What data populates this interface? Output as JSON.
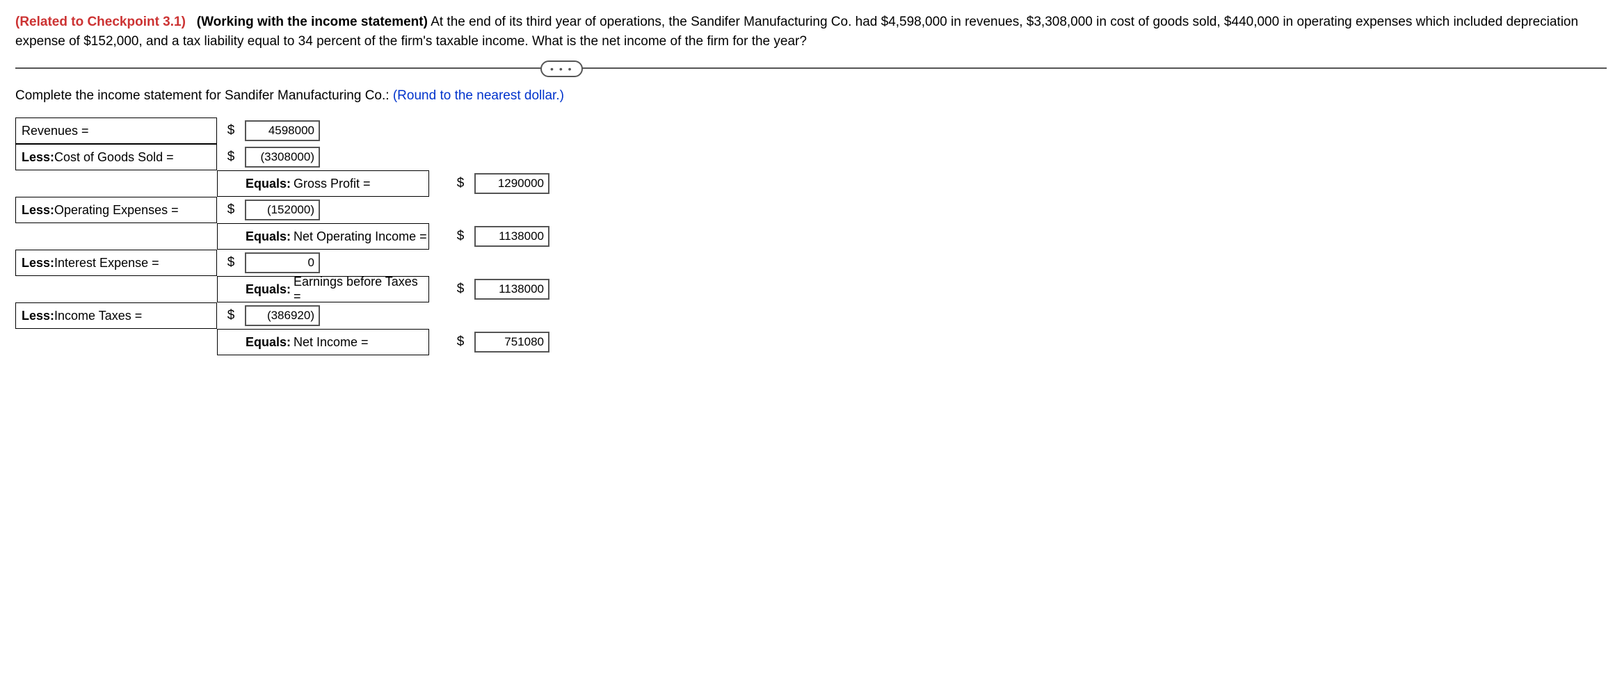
{
  "problem": {
    "checkpoint": "(Related to Checkpoint 3.1)",
    "title": "(Working with the income statement)",
    "body": " At the end of its third year of operations, the Sandifer Manufacturing Co. had $4,598,000 in revenues, $3,308,000 in cost of goods sold, $440,000 in operating expenses which included depreciation expense of $152,000, and a tax liability equal to 34 percent of the firm's taxable income.  What is the net income of the firm for the year?"
  },
  "instruction": {
    "prefix": "Complete the income statement for Sandifer Manufacturing Co.:",
    "hint": " (Round to the nearest dollar.)"
  },
  "rows": {
    "revenues": {
      "label": "Revenues =",
      "value": "4598000"
    },
    "cogs": {
      "label_prefix": "Less:",
      "label_rest": " Cost of Goods Sold =",
      "value": "(3308000)"
    },
    "gross_profit": {
      "equals_prefix": "Equals:",
      "equals_rest": " Gross Profit =",
      "value": "1290000"
    },
    "opex": {
      "label_prefix": "Less:",
      "label_rest": " Operating Expenses =",
      "value": "(152000)"
    },
    "noi": {
      "equals_prefix": "Equals:",
      "equals_rest": " Net Operating Income =",
      "value": "1138000"
    },
    "interest": {
      "label_prefix": "Less:",
      "label_rest": " Interest Expense =",
      "value": "0"
    },
    "ebt": {
      "equals_prefix": "Equals:",
      "equals_rest": " Earnings before Taxes =",
      "value": "1138000"
    },
    "taxes": {
      "label_prefix": "Less:",
      "label_rest": " Income Taxes =",
      "value": "(386920)"
    },
    "net_income": {
      "equals_prefix": "Equals:",
      "equals_rest": " Net Income =",
      "value": "751080"
    }
  },
  "dollar": "$",
  "ellipsis": "• • •"
}
